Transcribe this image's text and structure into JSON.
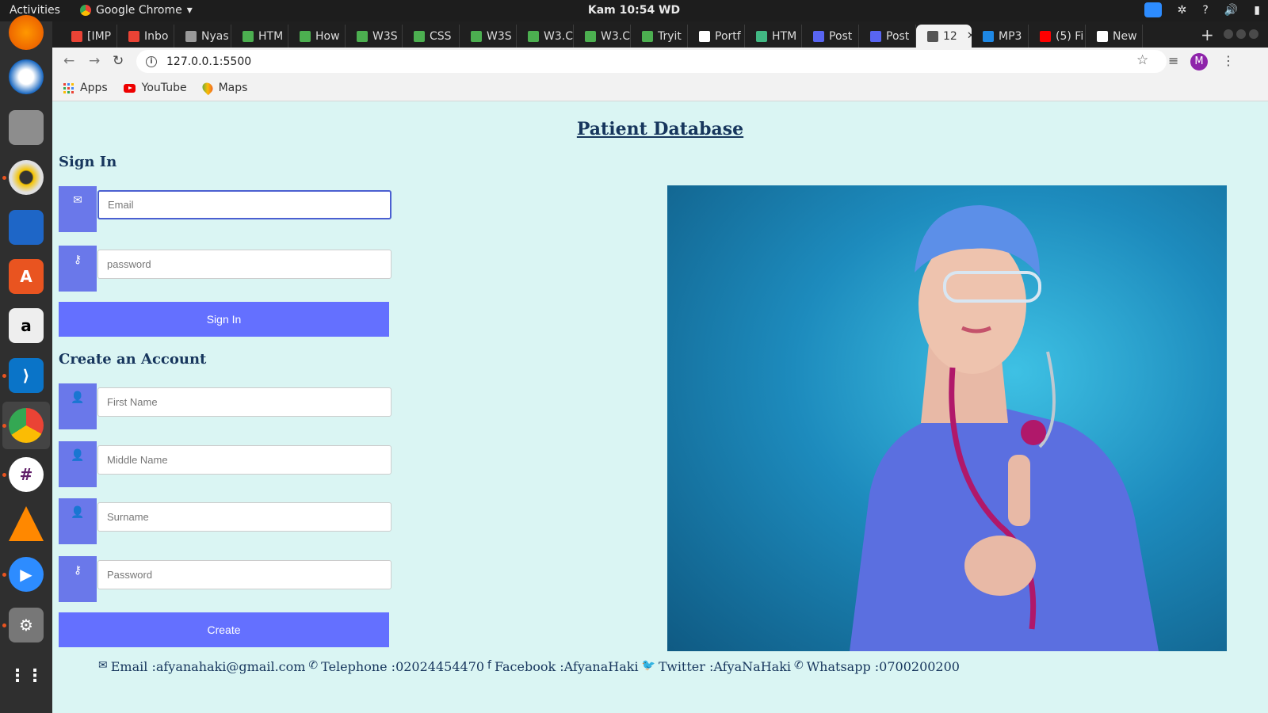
{
  "system": {
    "activities": "Activities",
    "app_name": "Google Chrome",
    "clock": "Kam 10:54 WD"
  },
  "tabs": [
    {
      "label": "[IMP",
      "color": "#ea4335"
    },
    {
      "label": "Inbo",
      "color": "#ea4335"
    },
    {
      "label": "Nyas",
      "color": "#999999"
    },
    {
      "label": "HTM",
      "color": "#4caf50"
    },
    {
      "label": "How",
      "color": "#4caf50"
    },
    {
      "label": "W3S",
      "color": "#4caf50"
    },
    {
      "label": "CSS",
      "color": "#4caf50"
    },
    {
      "label": "W3S",
      "color": "#4caf50"
    },
    {
      "label": "W3.C",
      "color": "#4caf50"
    },
    {
      "label": "W3.C",
      "color": "#4caf50"
    },
    {
      "label": "Tryit",
      "color": "#4caf50"
    },
    {
      "label": "Portf",
      "color": "#ffffff"
    },
    {
      "label": "HTM",
      "color": "#41b883"
    },
    {
      "label": "Post",
      "color": "#5865f2"
    },
    {
      "label": "Post",
      "color": "#5865f2"
    },
    {
      "label": "12",
      "color": "#555555",
      "active": true
    },
    {
      "label": "MP3",
      "color": "#1e88e5"
    },
    {
      "label": "(5) Fi",
      "color": "#ff0000"
    },
    {
      "label": "New",
      "color": "#ffffff"
    }
  ],
  "browser": {
    "url": "127.0.0.1:5500",
    "avatar_letter": "M"
  },
  "bookmarks": {
    "apps": "Apps",
    "youtube": "YouTube",
    "maps": "Maps"
  },
  "page": {
    "title": "Patient Database",
    "signin_heading": "Sign In",
    "email_placeholder": "Email",
    "password_placeholder": "password",
    "signin_button": "Sign In",
    "create_heading": "Create an Account",
    "first_name_placeholder": "First Name",
    "middle_name_placeholder": "Middle Name",
    "surname_placeholder": "Surname",
    "create_password_placeholder": "Password",
    "create_button": "Create",
    "accent_color": "#6470ff"
  },
  "footer": {
    "email": "Email :afyanahaki@gmail.com",
    "telephone": "Telephone :02024454470",
    "facebook": "Facebook :AfyanaHaki",
    "twitter": "Twitter :AfyaNaHaki",
    "whatsapp": "Whatsapp :0700200200"
  }
}
